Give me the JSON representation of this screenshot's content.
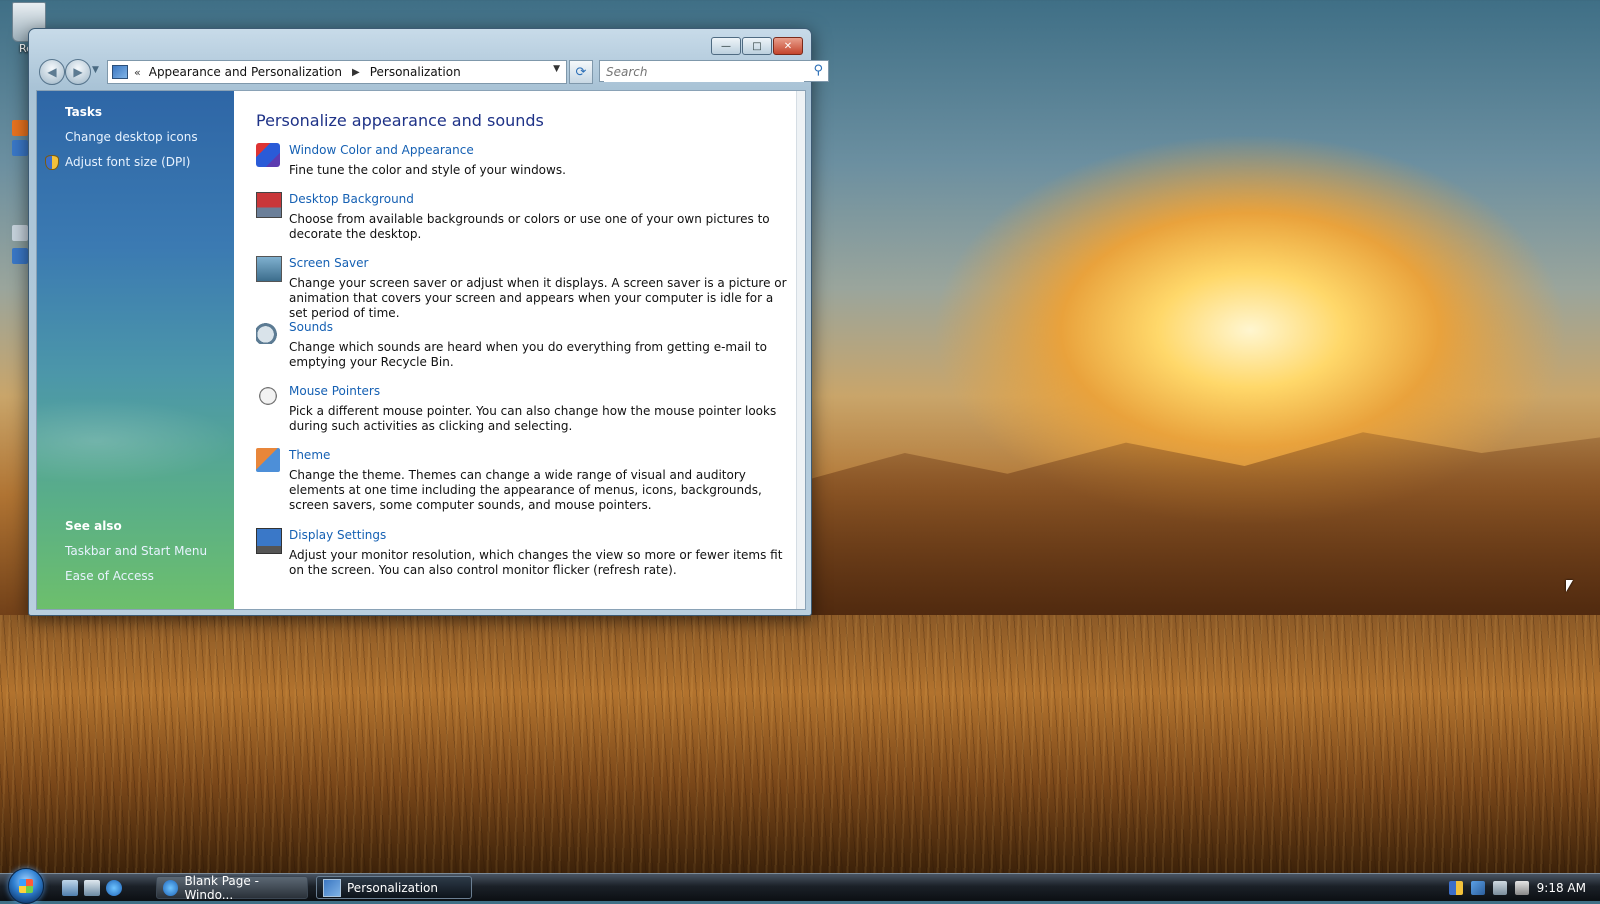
{
  "desktop": {
    "icons": [
      {
        "label": "Rec",
        "name": "recycle-bin-icon"
      }
    ]
  },
  "window": {
    "controls": {
      "minimize": "—",
      "maximize": "□",
      "close": "✕"
    },
    "nav": {
      "back_icon": "back-arrow-icon",
      "forward_icon": "forward-arrow-icon"
    },
    "address": {
      "overflow": "«",
      "crumbs": [
        "Appearance and Personalization",
        "Personalization"
      ]
    },
    "search": {
      "placeholder": "Search"
    },
    "sidebar": {
      "tasks_heading": "Tasks",
      "tasks": [
        {
          "label": "Change desktop icons"
        },
        {
          "label": "Adjust font size (DPI)",
          "icon": "shield-icon"
        }
      ],
      "see_also_heading": "See also",
      "see_also": [
        {
          "label": "Taskbar and Start Menu"
        },
        {
          "label": "Ease of Access"
        }
      ]
    },
    "main": {
      "title": "Personalize appearance and sounds",
      "items": [
        {
          "title": "Window Color and Appearance",
          "desc": "Fine tune the color and style of your windows.",
          "icon": "window-color-icon"
        },
        {
          "title": "Desktop Background",
          "desc": "Choose from available backgrounds or colors or use one of your own pictures to decorate the desktop.",
          "icon": "desktop-background-icon"
        },
        {
          "title": "Screen Saver",
          "desc": "Change your screen saver or adjust when it displays. A screen saver is a picture or animation that covers your screen and appears when your computer is idle for a set period of time.",
          "icon": "screen-saver-icon"
        },
        {
          "title": "Sounds",
          "desc": "Change which sounds are heard when you do everything from getting e-mail to emptying your Recycle Bin.",
          "icon": "sounds-icon"
        },
        {
          "title": "Mouse Pointers",
          "desc": "Pick a different mouse pointer. You can also change how the mouse pointer looks during such activities as clicking and selecting.",
          "icon": "mouse-pointers-icon"
        },
        {
          "title": "Theme",
          "desc": "Change the theme. Themes can change a wide range of visual and auditory elements at one time including the appearance of menus, icons, backgrounds, screen savers, some computer sounds, and mouse pointers.",
          "icon": "theme-icon"
        },
        {
          "title": "Display Settings",
          "desc": "Adjust your monitor resolution, which changes the view so more or fewer items fit on the screen. You can also control monitor flicker (refresh rate).",
          "icon": "display-settings-icon"
        }
      ]
    }
  },
  "taskbar": {
    "tasks": [
      {
        "label": "Blank Page - Windo...",
        "icon": "internet-explorer-icon"
      },
      {
        "label": "Personalization",
        "icon": "control-panel-icon"
      }
    ],
    "clock": "9:18 AM"
  },
  "colors": {
    "link": "#1560b3",
    "title": "#1e3287",
    "sidebar_top": "#2e66a6",
    "sidebar_bottom": "#6dbf6c"
  }
}
